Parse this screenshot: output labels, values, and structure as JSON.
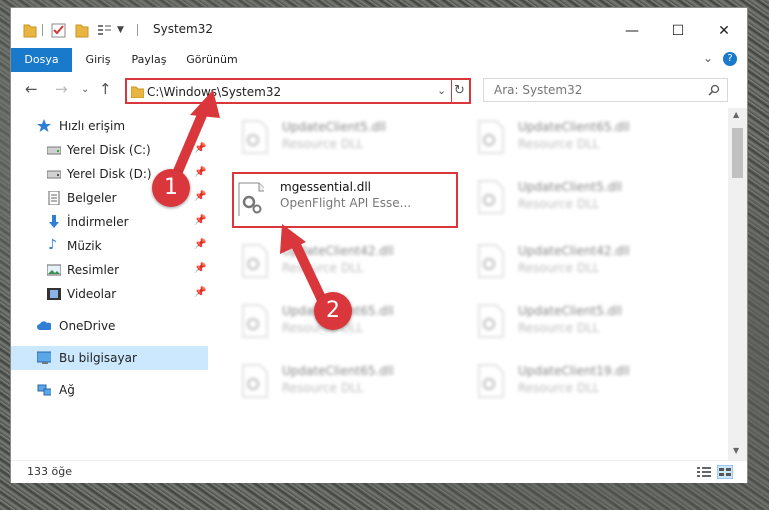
{
  "window": {
    "title": "System32",
    "controls": {
      "minimize": "—",
      "maximize": "☐",
      "close": "✕"
    }
  },
  "ribbon": {
    "tabs": [
      "Dosya",
      "Giriş",
      "Paylaş",
      "Görünüm"
    ],
    "expand": "⌄",
    "help": "?"
  },
  "address": {
    "path": "C:\\Windows\\System32",
    "search_placeholder": "Ara: System32"
  },
  "sidebar": {
    "items": [
      {
        "label": "Hızlı erişim",
        "icon": "star-icon",
        "pinned": false
      },
      {
        "label": "Yerel Disk (C:)",
        "icon": "disk-icon",
        "pinned": true
      },
      {
        "label": "Yerel Disk (D:)",
        "icon": "disk-icon",
        "pinned": true
      },
      {
        "label": "Belgeler",
        "icon": "documents-icon",
        "pinned": true
      },
      {
        "label": "İndirmeler",
        "icon": "download-icon",
        "pinned": true
      },
      {
        "label": "Müzik",
        "icon": "music-icon",
        "pinned": true
      },
      {
        "label": "Resimler",
        "icon": "pictures-icon",
        "pinned": true
      },
      {
        "label": "Videolar",
        "icon": "video-icon",
        "pinned": true
      },
      {
        "label": "OneDrive",
        "icon": "cloud-icon",
        "pinned": false
      },
      {
        "label": "Bu bilgisayar",
        "icon": "computer-icon",
        "pinned": false
      },
      {
        "label": "Ağ",
        "icon": "network-icon",
        "pinned": false
      }
    ]
  },
  "files": [
    {
      "name": "UpdateClient5.dll",
      "type": "Resource DLL"
    },
    {
      "name": "UpdateClient65.dll",
      "type": "Resource DLL"
    },
    {
      "name": "mgessential.dll",
      "type": "OpenFlight API Esse..."
    },
    {
      "name": "UpdateClient5.dll",
      "type": "Resource DLL"
    },
    {
      "name": "UpdateClient42.dll",
      "type": "Resource DLL"
    },
    {
      "name": "UpdateClient42.dll",
      "type": "Resource DLL"
    },
    {
      "name": "UpdateClient65.dll",
      "type": "Resource DLL"
    },
    {
      "name": "UpdateClient5.dll",
      "type": "Resource DLL"
    },
    {
      "name": "UpdateClient65.dll",
      "type": "Resource DLL"
    },
    {
      "name": "UpdateClient19.dll",
      "type": "Resource DLL"
    }
  ],
  "status": {
    "count": "133 öğe"
  },
  "annotations": {
    "badge1": "1",
    "badge2": "2"
  },
  "colors": {
    "accent": "#1979ca",
    "highlight": "#d9373b",
    "selected": "#cce8ff"
  }
}
